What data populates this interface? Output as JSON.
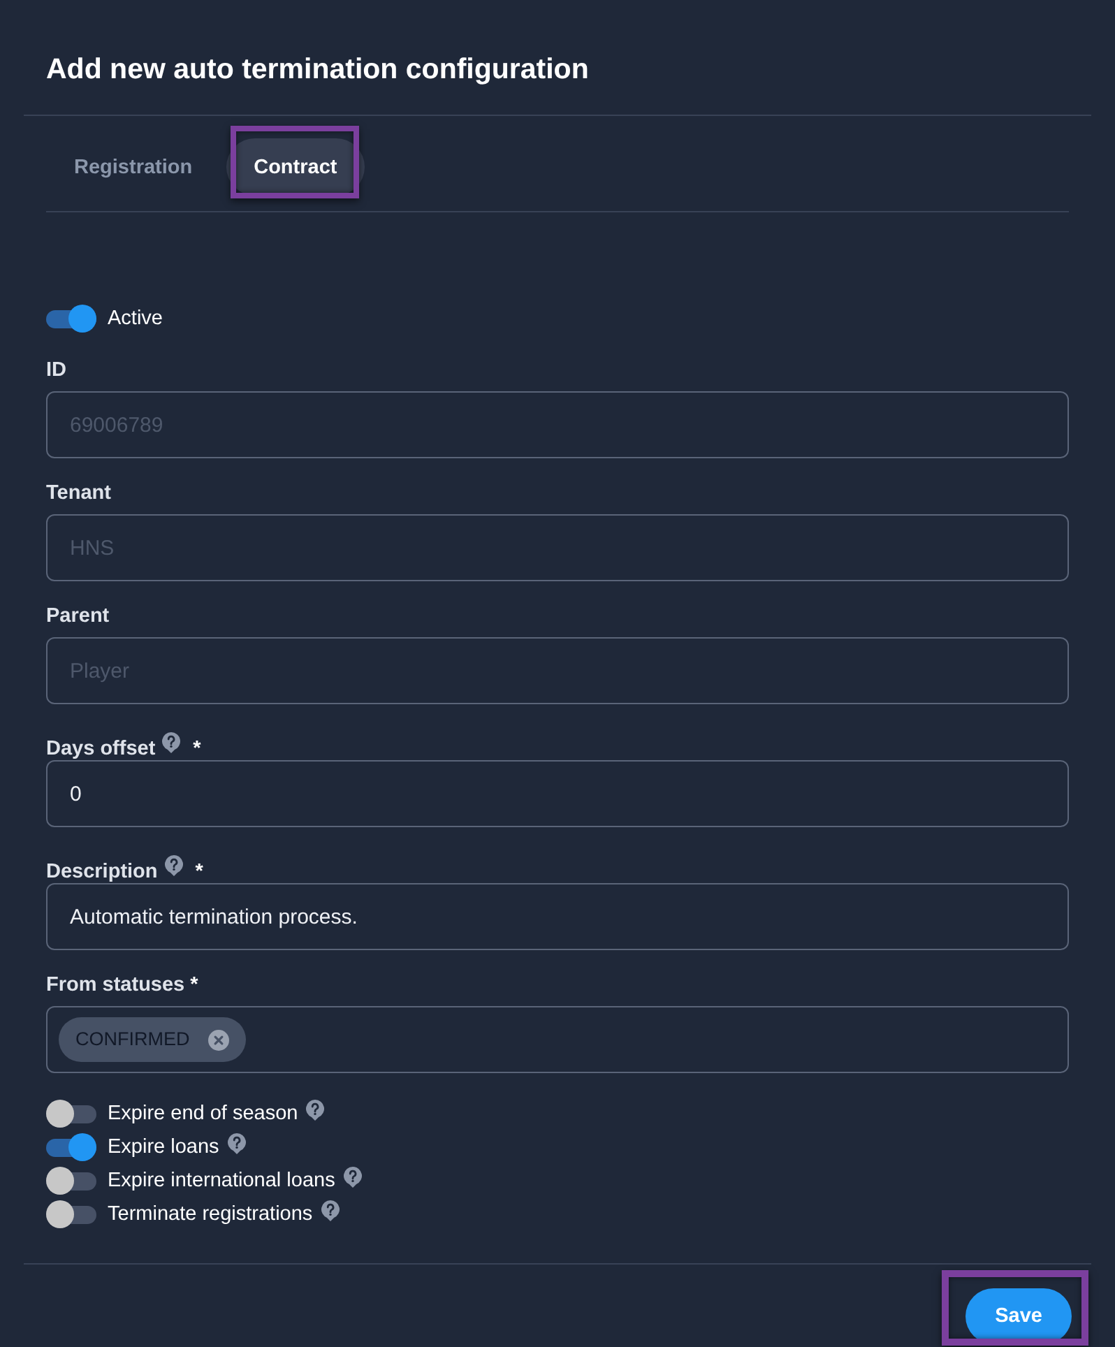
{
  "title": "Add new auto termination configuration",
  "tabs": [
    {
      "label": "Registration",
      "selected": false,
      "highlighted": false
    },
    {
      "label": "Contract",
      "selected": true,
      "highlighted": true
    }
  ],
  "active_toggle": {
    "label": "Active",
    "on": true
  },
  "fields": [
    {
      "kind": "text",
      "label": "ID",
      "help": false,
      "value": "69006789",
      "disabled": true
    },
    {
      "kind": "text",
      "label": "Tenant",
      "help": false,
      "value": "HNS",
      "disabled": true
    },
    {
      "kind": "text",
      "label": "Parent",
      "help": false,
      "value": "Player",
      "disabled": true
    },
    {
      "kind": "text",
      "label": "Days offset",
      "help": true,
      "required_mark": "*",
      "value": "0",
      "disabled": false
    },
    {
      "kind": "text",
      "label": "Description",
      "help": true,
      "required_mark": "*",
      "value": "Automatic termination process.",
      "disabled": false
    },
    {
      "kind": "tags",
      "label": "From statuses",
      "help": false,
      "required_mark": "*",
      "tags": [
        {
          "label": "CONFIRMED"
        }
      ]
    }
  ],
  "options": [
    {
      "label": "Expire end of season",
      "on": false,
      "help": true
    },
    {
      "label": "Expire loans",
      "on": true,
      "help": true
    },
    {
      "label": "Expire international loans",
      "on": false,
      "help": true
    },
    {
      "label": "Terminate registrations",
      "on": false,
      "help": true
    }
  ],
  "save_button": {
    "label": "Save",
    "highlighted": true
  }
}
